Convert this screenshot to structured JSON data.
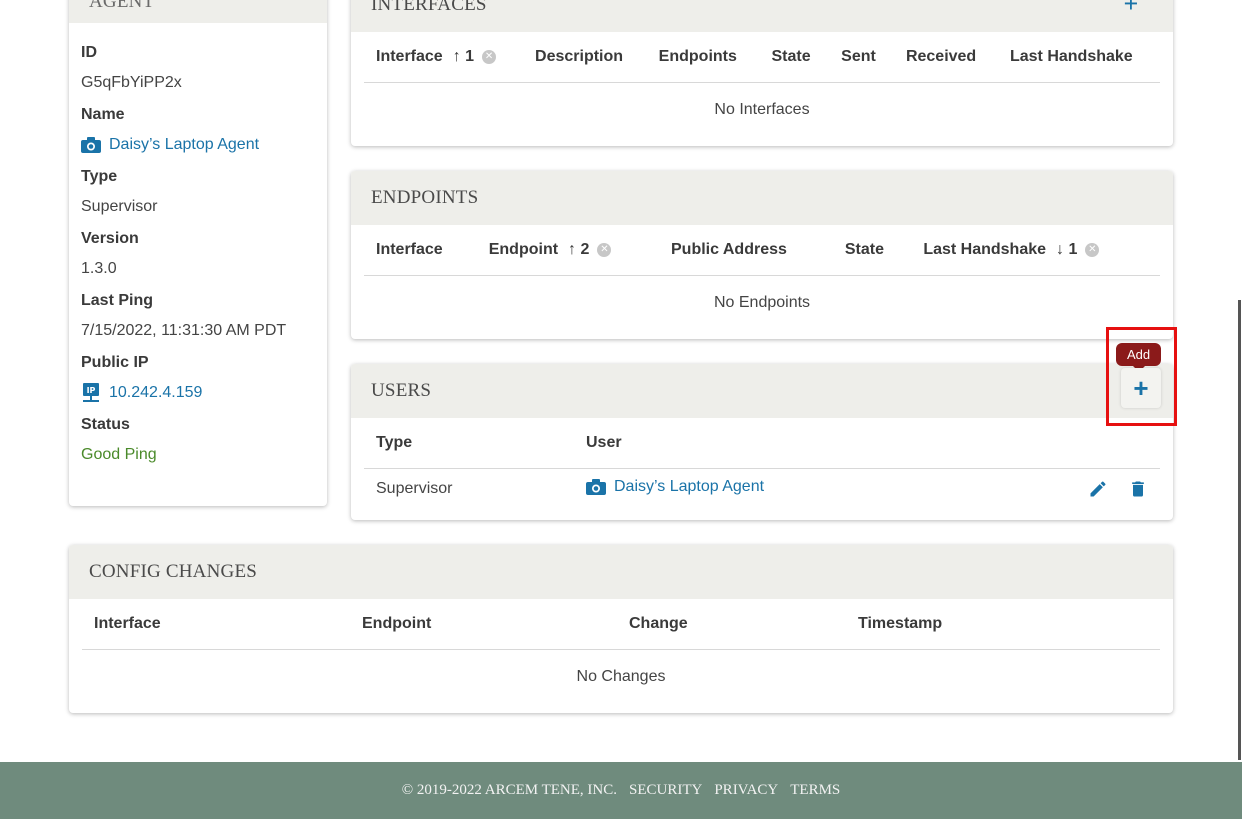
{
  "agent": {
    "title": "AGENT",
    "id_label": "ID",
    "id_value": "G5qFbYiPP2x",
    "name_label": "Name",
    "name_value": "Daisy’s Laptop Agent",
    "type_label": "Type",
    "type_value": "Supervisor",
    "version_label": "Version",
    "version_value": "1.3.0",
    "last_ping_label": "Last Ping",
    "last_ping_value": "7/15/2022, 11:31:30 AM PDT",
    "public_ip_label": "Public IP",
    "public_ip_value": "10.242.4.159",
    "status_label": "Status",
    "status_value": "Good Ping"
  },
  "interfaces": {
    "title": "INTERFACES",
    "columns": [
      "Interface",
      "Description",
      "Endpoints",
      "State",
      "Sent",
      "Received",
      "Last Handshake"
    ],
    "sort_interface": "↑ 1",
    "empty": "No Interfaces"
  },
  "endpoints": {
    "title": "ENDPOINTS",
    "columns": [
      "Interface",
      "Endpoint",
      "Public Address",
      "State",
      "Last Handshake"
    ],
    "sort_endpoint": "↑ 2",
    "sort_last_handshake": "↓ 1",
    "empty": "No Endpoints"
  },
  "users": {
    "title": "USERS",
    "columns": [
      "Type",
      "User"
    ],
    "rows": [
      {
        "type": "Supervisor",
        "user": "Daisy’s Laptop Agent"
      }
    ],
    "add_tooltip": "Add"
  },
  "config_changes": {
    "title": "CONFIG CHANGES",
    "columns": [
      "Interface",
      "Endpoint",
      "Change",
      "Timestamp"
    ],
    "empty": "No Changes"
  },
  "footer": {
    "copyright": "© 2019-2022 ARCEM TENE, INC.",
    "security": "SECURITY",
    "privacy": "PRIVACY",
    "terms": "TERMS"
  },
  "colors": {
    "accent": "#1a73a8",
    "status_good": "#4a8a2a",
    "tooltip_bg": "#8b1a1a",
    "footer_bg": "#6f8b7d",
    "highlight": "#e61010"
  }
}
